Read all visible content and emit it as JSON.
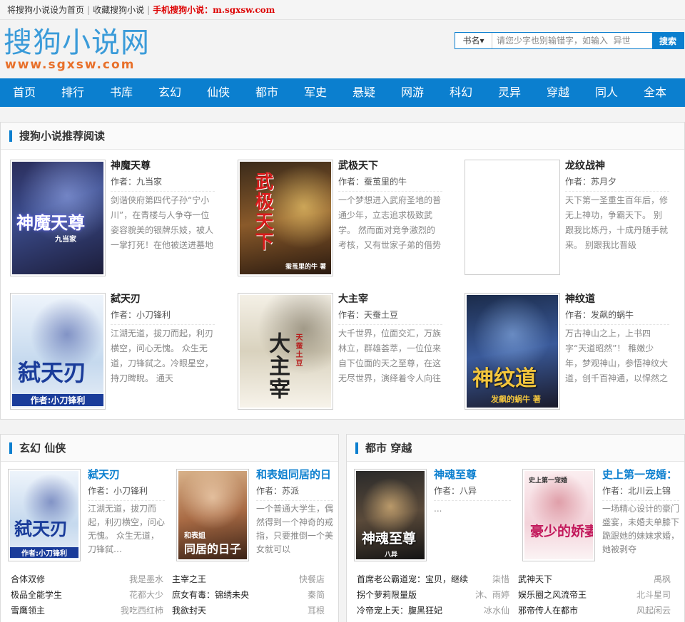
{
  "topbar": {
    "set_home": "将搜狗小说设为首页",
    "bookmark": "收藏搜狗小说",
    "mobile_label": "手机搜狗小说：",
    "mobile_url": "m.sgxsw.com"
  },
  "logo": {
    "cn": "搜狗小说网",
    "en": "www.sgxsw.com"
  },
  "search": {
    "select": "书名▾",
    "placeholder": "请您少字也别输错字，如输入  异世",
    "button": "搜索"
  },
  "nav": [
    "首页",
    "排行",
    "书库",
    "玄幻",
    "仙侠",
    "都市",
    "军史",
    "悬疑",
    "网游",
    "科幻",
    "灵异",
    "穿越",
    "同人",
    "全本"
  ],
  "recommend": {
    "title": "搜狗小说推荐阅读",
    "books": [
      {
        "title": "神魔天尊",
        "author": "作者：九当家",
        "desc": "剑谐侠府第四代子孙“宁小川”，在青楼与人争夺一位姿容貌美的银牌乐妓，被人一掌打死！在他被送进墓地",
        "cover": {
          "text": "神魔天尊",
          "sub": "九当家"
        }
      },
      {
        "title": "武极天下",
        "author": "作者：蚕茧里的牛",
        "desc": "一个梦想进入武府圣地的普通少年，立志追求极致武学。 然而面对竞争激烈的考核，又有世家子弟的借势",
        "cover": {
          "text": "武极天下",
          "sub": "蚕茧里的牛 著"
        }
      },
      {
        "title": "龙纹战神",
        "author": "作者：苏月夕",
        "desc": "天下第一圣重生百年后，修无上神功，争霸天下。 别跟我比炼丹，十成丹随手就来。 别跟我比晋级",
        "cover": {
          "text": "",
          "sub": ""
        }
      },
      {
        "title": "弑天刃",
        "author": "作者：小刀锋利",
        "desc": "江湖无道，拔刀而起，利刃横空，问心无愧。 众生无道，刀锋弑之。冷眼星空，持刀睥睨。 通天",
        "cover": {
          "text": "弑天刃",
          "sub": "作者:小刀锋利"
        }
      },
      {
        "title": "大主宰",
        "author": "作者：天蚕土豆",
        "desc": "大千世界，位面交汇，万族林立，群雄荟萃，一位位来自下位面的天之至尊，在这无尽世界，演绎着令人向往",
        "cover": {
          "text": "大主宰",
          "sub": "天蚕土豆"
        }
      },
      {
        "title": "神纹道",
        "author": "作者：发飙的蜗牛",
        "desc": "万古神山之上，上书四字“天道昭然”！ 稚嫩少年，梦观神山，参悟神纹大道，创千百神通，以悍然之姿",
        "cover": {
          "text": "神纹道",
          "sub": "发飙的蜗牛 著"
        }
      }
    ]
  },
  "section_left": {
    "title": "玄幻  仙侠",
    "books": [
      {
        "title": "弑天刃",
        "author": "作者：小刀锋利",
        "desc": "江湖无道，拔刀而起，利刃横空，问心无愧。 众生无道，刀锋弑…",
        "cover": {
          "text": "弑天刃",
          "sub": "作者:小刀锋利"
        }
      },
      {
        "title": "和表姐同居的日",
        "author": "作者：苏派",
        "desc": "一个普通大学生，偶然得到一个神奇的戒指，只要推倒一个美女就可以",
        "cover": {
          "text": "同居的日子",
          "sub": "和表姐"
        }
      }
    ],
    "list": [
      {
        "t": "合体双修",
        "a": "我是墨水"
      },
      {
        "t": "主宰之王",
        "a": "快餐店"
      },
      {
        "t": "极品全能学生",
        "a": "花都大少"
      },
      {
        "t": "庶女有毒：锦绣未央",
        "a": "秦简"
      },
      {
        "t": "雪鹰领主",
        "a": "我吃西红柿"
      },
      {
        "t": "我欲封天",
        "a": "耳根"
      }
    ]
  },
  "section_right": {
    "title": "都市  穿越",
    "books": [
      {
        "title": "神魂至尊",
        "author": "作者：八异",
        "desc": "...",
        "cover": {
          "text": "神魂至尊",
          "sub": "八异"
        }
      },
      {
        "title": "史上第一宠婚：",
        "author": "作者：北川云上锦",
        "desc": "一场精心设计的豪门盛宴，未婚夫单膝下跪跟她的妹妹求婚，她被剥夺",
        "cover": {
          "text": "豪少的娇妻",
          "sub": "史上第一宠婚"
        }
      }
    ],
    "list": [
      {
        "t": "首席老公霸道宠：宝贝，继续",
        "a": "柒惜"
      },
      {
        "t": "武神天下",
        "a": "禹枫"
      },
      {
        "t": "拐个萝莉限量版",
        "a": "沐、雨婷"
      },
      {
        "t": "娱乐圈之风流帝王",
        "a": "北斗星司"
      },
      {
        "t": "冷帝宠上天：腹黑狂妃",
        "a": "冰水仙"
      },
      {
        "t": "邪帝传人在都市",
        "a": "风起闲云"
      }
    ]
  },
  "colors": {
    "accent": "#0b7fcf",
    "logo_blue": "#3a9bd9",
    "logo_orange": "#e8702a",
    "mobile_red": "#dd0000"
  }
}
